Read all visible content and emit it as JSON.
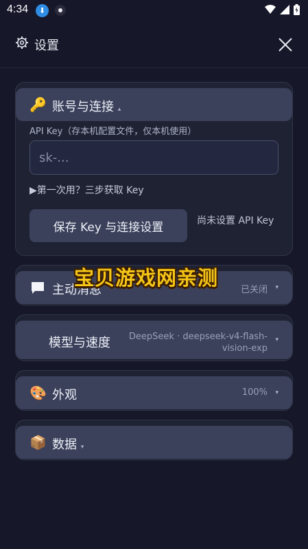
{
  "status_bar": {
    "time": "4:34"
  },
  "header": {
    "title": "设置",
    "icons": [
      "gear-icon",
      "close-icon"
    ]
  },
  "account_section": {
    "icon": "🔑",
    "title": "账号与连接",
    "caret": "▴",
    "api_key_label": "API Key（存本机配置文件，仅本机使用）",
    "api_key_placeholder": "sk-...",
    "first_time_hint": "▶第一次用？三步获取 Key",
    "save_button_label": "保存 Key 与连接设置",
    "key_status": "尚未设置 API Key"
  },
  "proactive_section": {
    "title": "主动消息",
    "value": "已关闭",
    "caret": "▾"
  },
  "model_section": {
    "title": "模型与速度",
    "value_line1": "DeepSeek · deepseek-v4-flash-",
    "value_line2": "vision-exp",
    "caret": "▾"
  },
  "appearance_section": {
    "icon": "🎨",
    "title": "外观",
    "value": "100%",
    "caret": "▾"
  },
  "data_section": {
    "icon": "📦",
    "title": "数据",
    "caret": "▾"
  },
  "watermark": {
    "text": "宝贝游戏网亲测"
  },
  "colors": {
    "background": "#161829",
    "card": "#1f2233",
    "card_header": "#3b405b",
    "watermark": "#f5c518"
  }
}
